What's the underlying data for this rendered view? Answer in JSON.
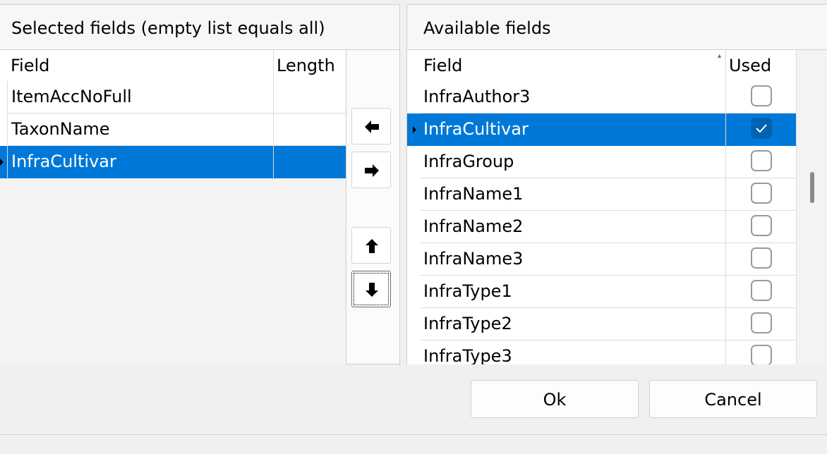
{
  "selected_panel": {
    "title": "Selected fields (empty list equals all)",
    "columns": {
      "field": "Field",
      "length": "Length"
    },
    "rows": [
      {
        "field": "ItemAccNoFull",
        "length": ""
      },
      {
        "field": "TaxonName",
        "length": ""
      },
      {
        "field": "InfraCultivar",
        "length": ""
      }
    ]
  },
  "available_panel": {
    "title": "Available fields",
    "columns": {
      "field": "Field",
      "used": "Used"
    },
    "rows": [
      {
        "field": "InfraAuthor3",
        "used": false
      },
      {
        "field": "InfraCultivar",
        "used": true
      },
      {
        "field": "InfraGroup",
        "used": false
      },
      {
        "field": "InfraName1",
        "used": false
      },
      {
        "field": "InfraName2",
        "used": false
      },
      {
        "field": "InfraName3",
        "used": false
      },
      {
        "field": "InfraType1",
        "used": false
      },
      {
        "field": "InfraType2",
        "used": false
      },
      {
        "field": "InfraType3",
        "used": false
      }
    ]
  },
  "icons": {
    "move_left": "arrow-left-icon",
    "move_right": "arrow-right-icon",
    "move_up": "arrow-up-icon",
    "move_down": "arrow-down-icon",
    "checkbox_checked": "checkmark-icon"
  },
  "colors": {
    "selection": "#0078d7",
    "checkbox_on": "#0063b1"
  },
  "buttons": {
    "ok": "Ok",
    "cancel": "Cancel"
  }
}
